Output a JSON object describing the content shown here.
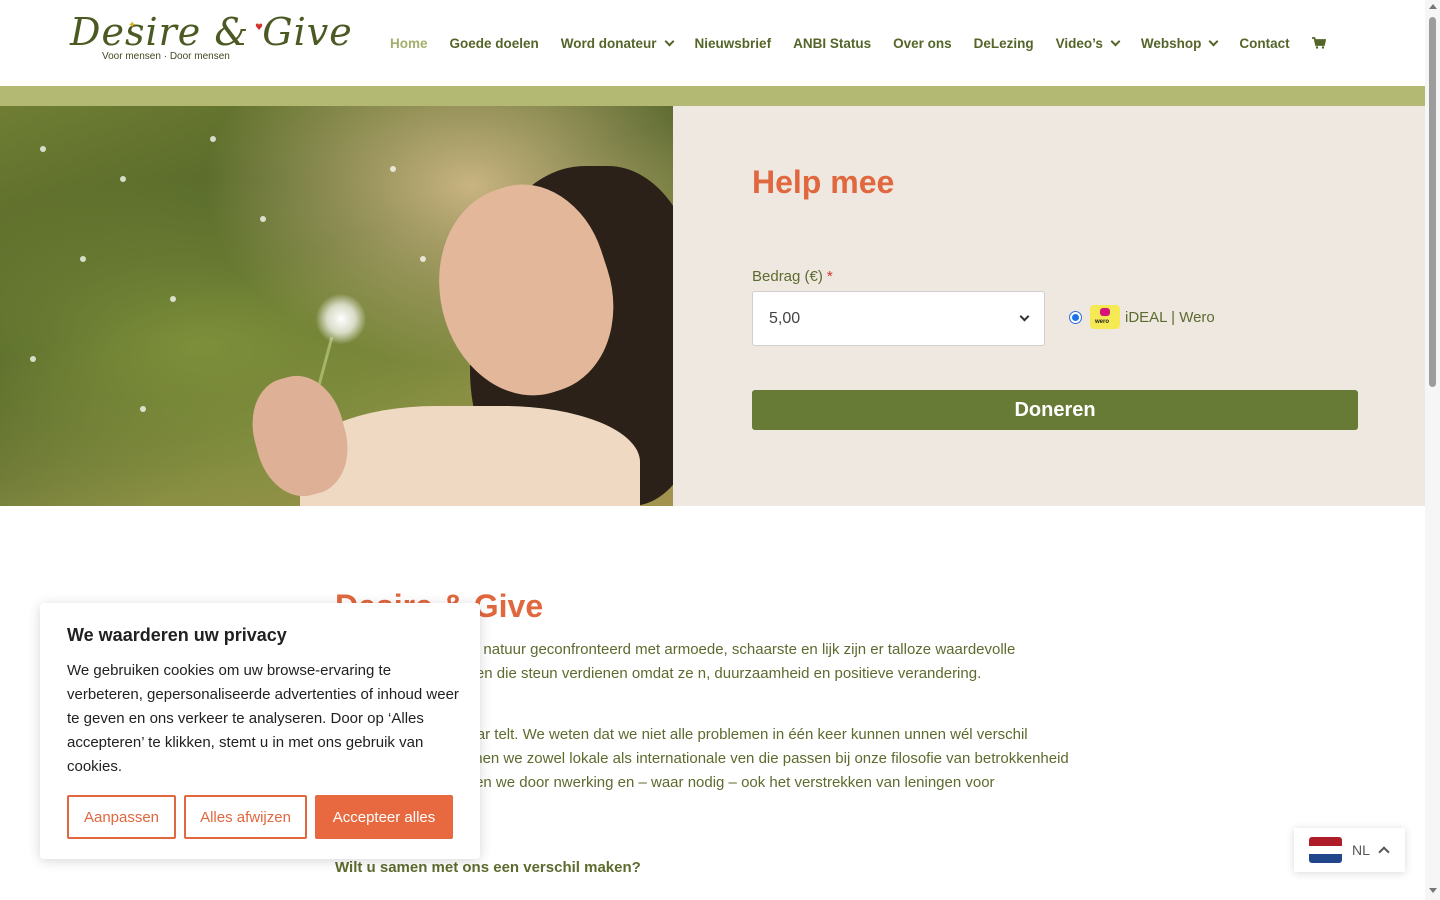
{
  "brand": {
    "logo_script": "Desire & Give",
    "tagline": "Voor mensen · Door mensen"
  },
  "nav": {
    "items": [
      {
        "label": "Home",
        "active": true,
        "dropdown": false
      },
      {
        "label": "Goede doelen",
        "active": false,
        "dropdown": false
      },
      {
        "label": "Word donateur",
        "active": false,
        "dropdown": true
      },
      {
        "label": "Nieuwsbrief",
        "active": false,
        "dropdown": false
      },
      {
        "label": "ANBI Status",
        "active": false,
        "dropdown": false
      },
      {
        "label": "Over ons",
        "active": false,
        "dropdown": false
      },
      {
        "label": "DeLezing",
        "active": false,
        "dropdown": false
      },
      {
        "label": "Video’s",
        "active": false,
        "dropdown": true
      },
      {
        "label": "Webshop",
        "active": false,
        "dropdown": true
      },
      {
        "label": "Contact",
        "active": false,
        "dropdown": false
      }
    ],
    "cart_icon": "cart-icon"
  },
  "donate": {
    "title": "Help mee",
    "amount_label": "Bedrag (€)",
    "required_mark": "*",
    "amount_value": "5,00",
    "payment_method": "iDEAL | Wero",
    "payment_icon_text": "wero",
    "button_label": "Doneren"
  },
  "content": {
    "title": "Desire & Give",
    "para1": "worden mens, dier en natuur geconfronteerd met armoede, schaarste en lijk zijn er talloze waardevolle initiatieven en projecten die steun verdienen omdat ze n, duurzaamheid en positieve verandering.",
    "para2": "oven we dat elk gebaar telt. We weten dat we niet alle problemen in één keer kunnen unnen wél verschil maken. Daarom steunen we zowel lokale als internationale ven die passen bij onze filosofie van betrokkenheid en compassie. Dit doen we door nwerking en – waar nodig – ook het verstrekken van leningen voor waardevolle",
    "para3": "Wilt u samen met ons een verschil maken?"
  },
  "cookie": {
    "title": "We waarderen uw privacy",
    "text": "We gebruiken cookies om uw browse-ervaring te verbeteren, gepersonaliseerde advertenties of inhoud weer te geven en ons verkeer te analyseren. Door op ‘Alles accepteren’ te klikken, stemt u in met ons gebruik van cookies.",
    "customize_label": "Aanpassen",
    "reject_label": "Alles afwijzen",
    "accept_label": "Accepteer alles"
  },
  "language": {
    "code": "NL",
    "flag_colors": [
      "#ae1c28",
      "#ffffff",
      "#21468b"
    ]
  },
  "colors": {
    "accent": "#e0673e",
    "brand_green": "#677a36",
    "band": "#b3b872",
    "panel_bg": "#efe8e1"
  }
}
